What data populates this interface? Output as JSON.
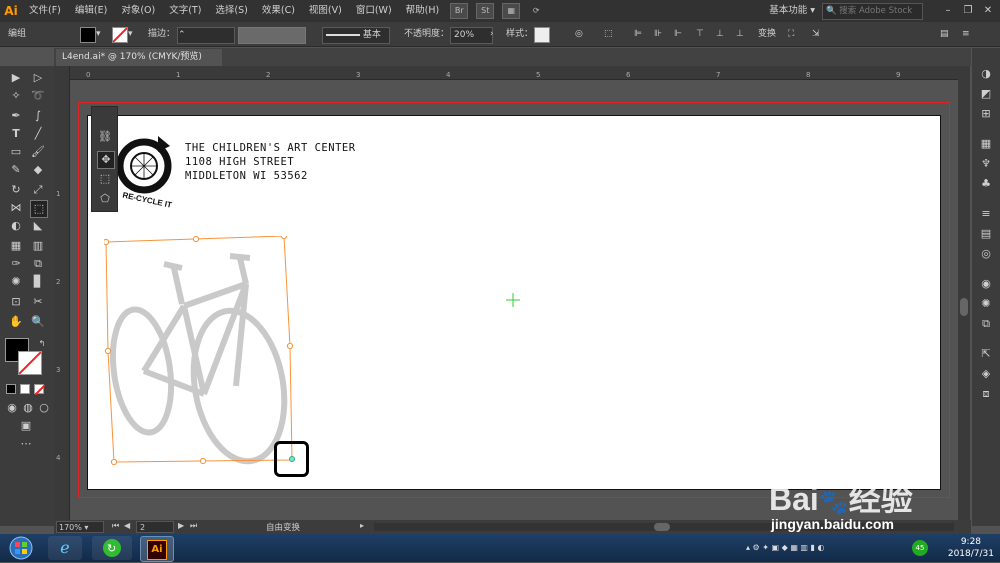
{
  "app": {
    "logo": "Ai"
  },
  "menu": [
    "文件(F)",
    "编辑(E)",
    "对象(O)",
    "文字(T)",
    "选择(S)",
    "效果(C)",
    "视图(V)",
    "窗口(W)",
    "帮助(H)"
  ],
  "menubar_icons": {
    "br": "Br",
    "st": "St"
  },
  "workspace": "基本功能",
  "search_placeholder": "搜索 Adobe Stock",
  "control": {
    "group_label": "编组",
    "stroke_label": "描边：",
    "line_label": "基本",
    "opacity_label": "不透明度：",
    "opacity_value": "20%",
    "style_label": "样式：",
    "transform_label": "变换"
  },
  "tab": {
    "title": "L4end.ai* @ 170% (CMYK/预览)",
    "close": "×"
  },
  "ruler_h": [
    "0",
    "1",
    "2",
    "3",
    "4",
    "5",
    "6",
    "7",
    "8",
    "9"
  ],
  "ruler_v": [
    "1",
    "2",
    "3",
    "4"
  ],
  "artwork": {
    "address_lines": [
      "THE CHILDREN'S ART CENTER",
      "1108 HIGH STREET",
      "MIDDLETON WI 53562"
    ],
    "logo_text": "RE-CYCLE IT"
  },
  "status": {
    "zoom": "170%",
    "page": "2",
    "tool": "自由变换"
  },
  "taskbar": {
    "app_label": "Ai",
    "time": "9:28",
    "date": "2018/7/31",
    "badge": "45"
  },
  "watermark": {
    "brand": "Bai",
    "brand2": "经验",
    "url": "jingyan.baidu.com"
  },
  "colors": {
    "selection": "#f7923a",
    "bleed": "#dd2222",
    "menubar": "#323232",
    "panel": "#3c3c3c",
    "accent_ai": "#ff9a00"
  }
}
